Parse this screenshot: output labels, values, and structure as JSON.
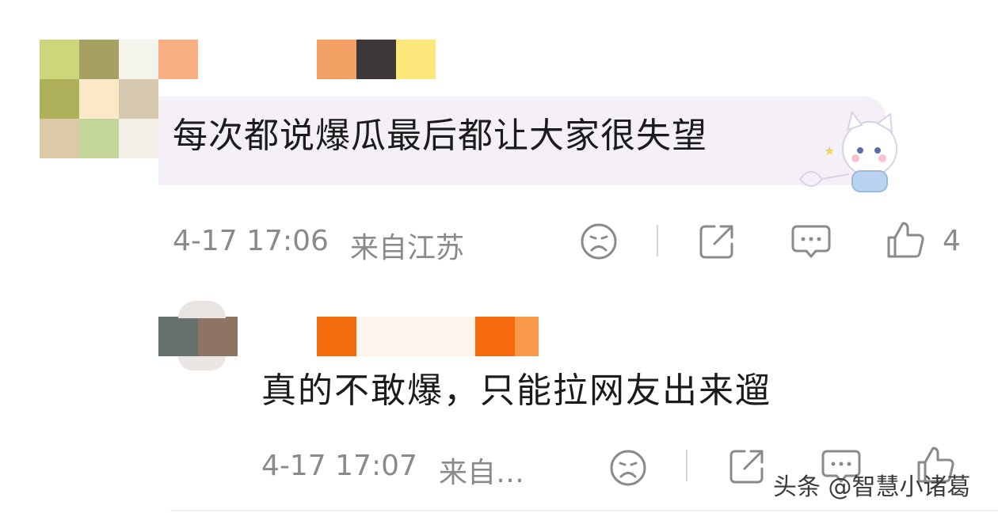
{
  "comment1": {
    "text": "每次都说爆瓜最后都让大家很失望",
    "time": "4-17 17:06",
    "location": "来自江苏",
    "like_count": "4",
    "icons": [
      "sad-face-icon",
      "share-icon",
      "comment-icon",
      "thumbs-up-icon"
    ]
  },
  "comment2": {
    "text": "真的不敢爆，只能拉网友出来遛",
    "time": "4-17 17:07",
    "location": "来自…",
    "icons": [
      "sad-face-icon",
      "share-icon",
      "comment-icon",
      "thumbs-up-icon"
    ]
  },
  "watermark": "头条 @智慧小诸葛",
  "colors": {
    "bubble": "#f5f0f8",
    "meta_text": "#8a8a8a",
    "icon_stroke": "#8a8a8a"
  }
}
